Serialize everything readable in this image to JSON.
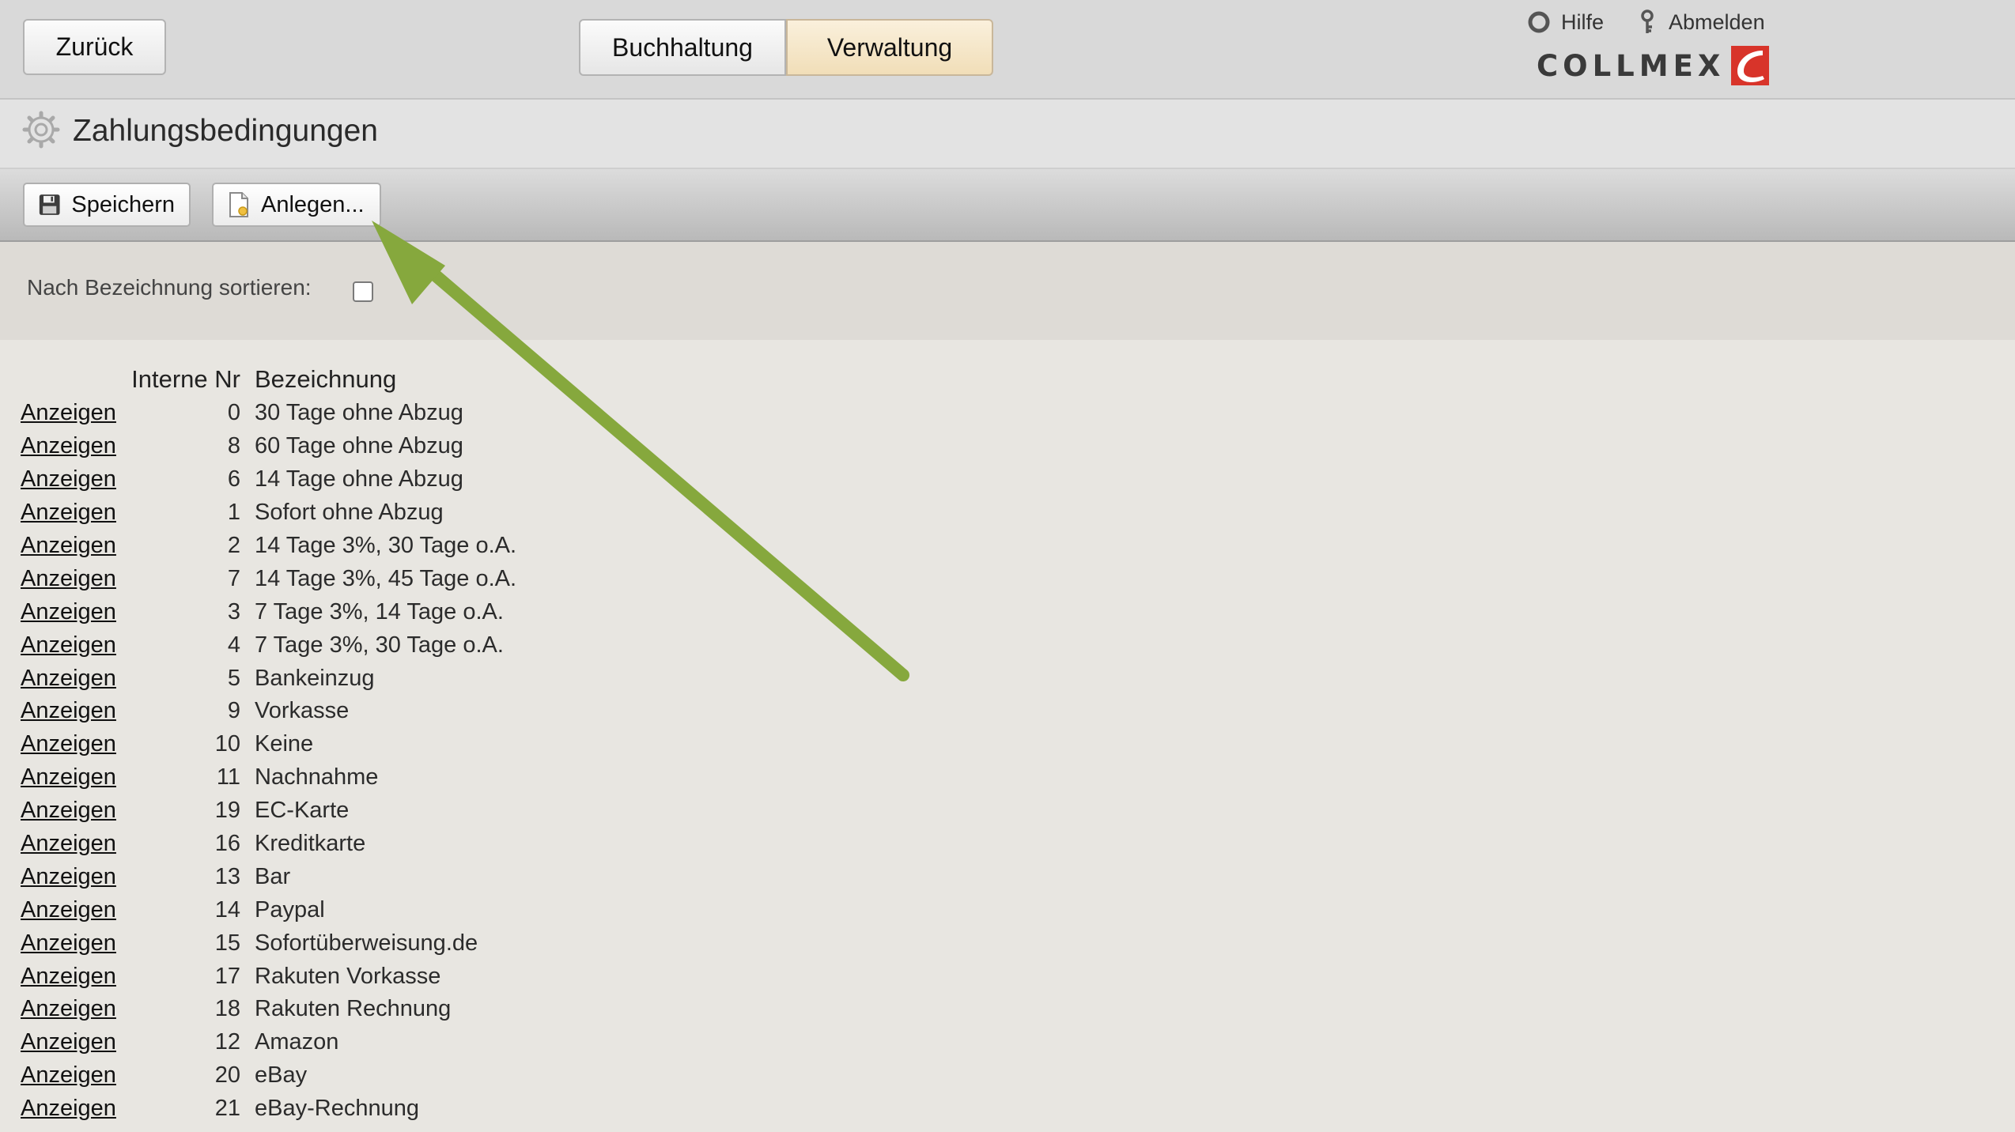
{
  "header": {
    "back_label": "Zurück",
    "tabs": [
      {
        "label": "Buchhaltung",
        "active": false
      },
      {
        "label": "Verwaltung",
        "active": true
      }
    ],
    "help_label": "Hilfe",
    "logout_label": "Abmelden",
    "logo_text": "COLLMEX"
  },
  "page": {
    "title": "Zahlungsbedingungen"
  },
  "toolbar": {
    "save_label": "Speichern",
    "create_label": "Anlegen..."
  },
  "filter": {
    "sort_label": "Nach Bezeichnung sortieren:",
    "sort_checked": false
  },
  "table": {
    "columns": [
      "",
      "Interne Nr",
      "Bezeichnung"
    ],
    "link_label": "Anzeigen",
    "rows": [
      {
        "nr": "0",
        "name": "30 Tage ohne Abzug"
      },
      {
        "nr": "8",
        "name": "60 Tage ohne Abzug"
      },
      {
        "nr": "6",
        "name": "14 Tage ohne Abzug"
      },
      {
        "nr": "1",
        "name": "Sofort ohne Abzug"
      },
      {
        "nr": "2",
        "name": "14 Tage 3%, 30 Tage o.A."
      },
      {
        "nr": "7",
        "name": "14 Tage 3%, 45 Tage o.A."
      },
      {
        "nr": "3",
        "name": "7 Tage 3%, 14 Tage o.A."
      },
      {
        "nr": "4",
        "name": "7 Tage 3%, 30 Tage o.A."
      },
      {
        "nr": "5",
        "name": "Bankeinzug"
      },
      {
        "nr": "9",
        "name": "Vorkasse"
      },
      {
        "nr": "10",
        "name": "Keine"
      },
      {
        "nr": "11",
        "name": "Nachnahme"
      },
      {
        "nr": "19",
        "name": "EC-Karte"
      },
      {
        "nr": "16",
        "name": "Kreditkarte"
      },
      {
        "nr": "13",
        "name": "Bar"
      },
      {
        "nr": "14",
        "name": "Paypal"
      },
      {
        "nr": "15",
        "name": "Sofortüberweisung.de"
      },
      {
        "nr": "17",
        "name": "Rakuten Vorkasse"
      },
      {
        "nr": "18",
        "name": "Rakuten Rechnung"
      },
      {
        "nr": "12",
        "name": "Amazon"
      },
      {
        "nr": "20",
        "name": "eBay"
      },
      {
        "nr": "21",
        "name": "eBay-Rechnung"
      }
    ]
  },
  "colors": {
    "active_tab": "#f1deb8",
    "annotation_arrow": "#86a83d",
    "logo_red": "#d8342a"
  }
}
